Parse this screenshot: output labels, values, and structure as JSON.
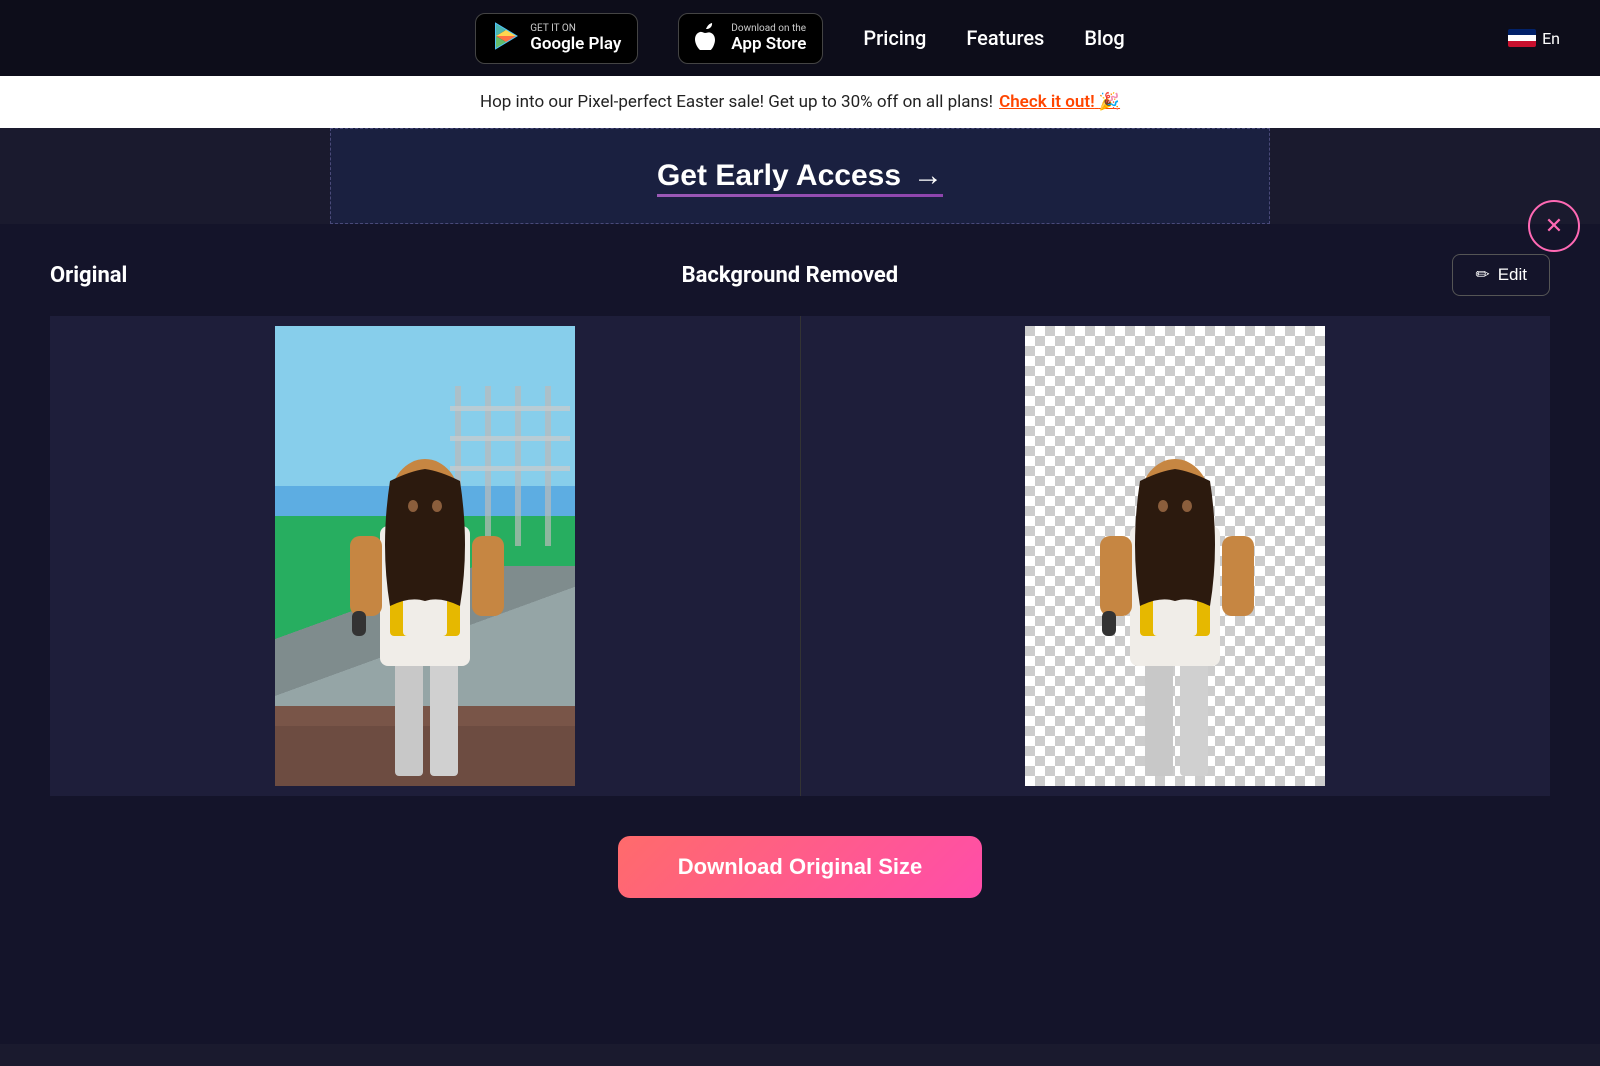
{
  "nav": {
    "google_play": {
      "top_line": "GET IT ON",
      "main_line": "Google Play"
    },
    "app_store": {
      "top_line": "Download on the",
      "main_line": "App Store"
    },
    "links": {
      "pricing": "Pricing",
      "features": "Features",
      "blog": "Blog"
    },
    "lang": "En"
  },
  "promo": {
    "text": "Hop into our Pixel-perfect Easter sale! Get up to 30% off on all plans!",
    "link_text": "Check it out!",
    "emoji": "🎉"
  },
  "early_access": {
    "label": "Get Early Access",
    "arrow": "→"
  },
  "main": {
    "original_label": "Original",
    "bg_removed_label": "Background Removed",
    "edit_icon": "✏",
    "edit_label": "Edit",
    "download_label": "Download Original Size"
  },
  "close_btn": "✕"
}
